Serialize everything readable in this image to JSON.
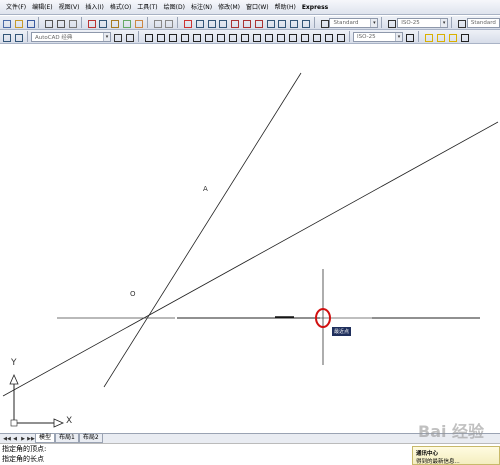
{
  "menu": [
    "文件(F)",
    "编辑(E)",
    "视图(V)",
    "插入(I)",
    "格式(O)",
    "工具(T)",
    "绘图(D)",
    "标注(N)",
    "修改(M)",
    "窗口(W)",
    "帮助(H)",
    "Express"
  ],
  "toolbar": {
    "text_style": "Standard",
    "dim_style": "ISO-25",
    "table_style": "Standard",
    "workspace": "AutoCAD 经典",
    "dim_style2": "ISO-25"
  },
  "canvas": {
    "label_A": "A",
    "label_O": "O",
    "snap_tooltip": "最近点",
    "ucs_x": "X",
    "ucs_y": "Y"
  },
  "layout_tabs": {
    "nav_first": "◀◀",
    "nav_prev": "◀",
    "nav_next": "▶",
    "nav_last": "▶▶",
    "tabs": [
      "模型",
      "布局1",
      "布局2"
    ]
  },
  "command": {
    "line1": "指定角的顶点:",
    "line2": "指定角的长点"
  },
  "notification": {
    "title": "通讯中心",
    "text": "得到的最新信息..."
  },
  "watermark": "Bai 经验"
}
